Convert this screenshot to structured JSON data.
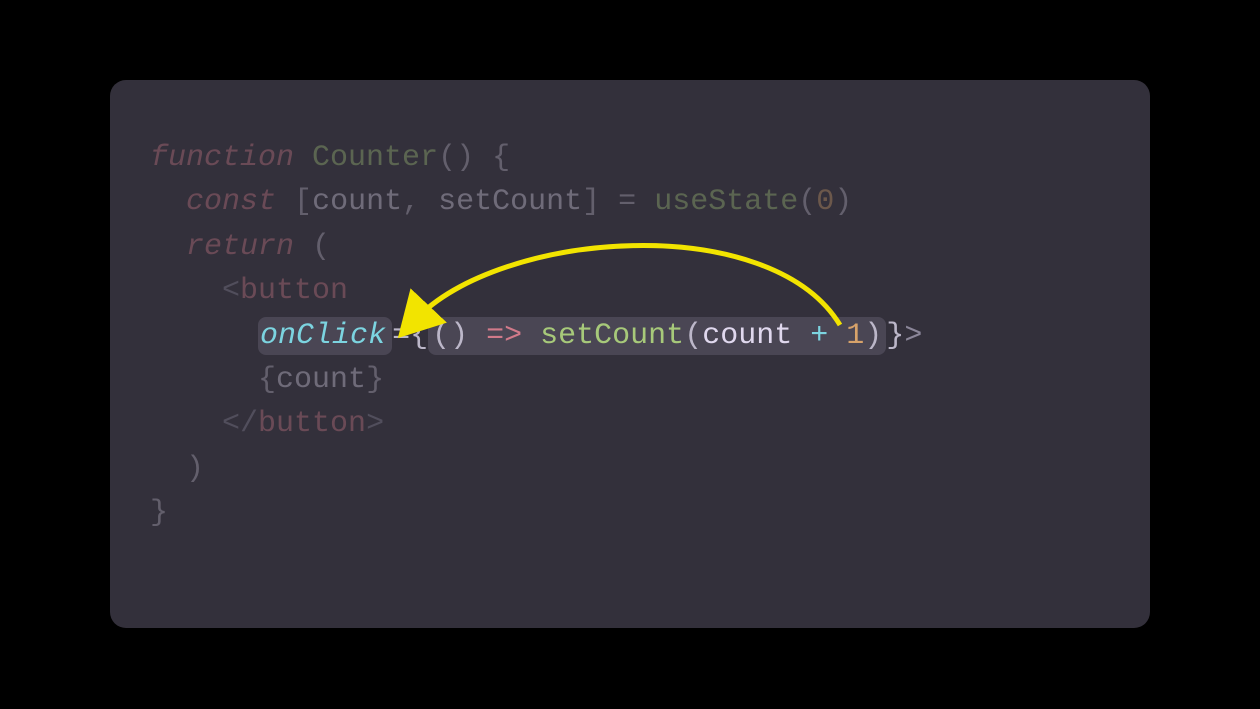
{
  "colors": {
    "panel_bg": "#33303b",
    "highlight_bg": "#4a4654",
    "arrow": "#f2e400",
    "keyword": "#d17a8a",
    "function": "#a7c97a",
    "variable": "#e0d8ee",
    "number": "#d7a26a",
    "attribute": "#7cd4e0",
    "punctuation": "#bcb7c9"
  },
  "code": {
    "l1": {
      "kw": "function",
      "sp1": " ",
      "fn": "Counter",
      "paren": "()",
      "sp2": " ",
      "brace": "{"
    },
    "l2": {
      "indent": "  ",
      "kw": "const",
      "sp1": " ",
      "lb": "[",
      "v1": "count",
      "comma": ",",
      "sp2": " ",
      "v2": "setCount",
      "rb": "]",
      "sp3": " ",
      "eq": "=",
      "sp4": " ",
      "fn": "useState",
      "lp": "(",
      "num": "0",
      "rp": ")"
    },
    "l3": {
      "indent": "  ",
      "kw": "return",
      "sp": " ",
      "paren": "("
    },
    "l4": {
      "indent": "    ",
      "lt": "<",
      "tag": "button"
    },
    "l5": {
      "indent": "      ",
      "attr": "onClick",
      "eq": "=",
      "lc": "{",
      "lp": "()",
      "sp1": " ",
      "arrow": "=>",
      "sp2": " ",
      "call": "setCount",
      "alp": "(",
      "arg": "count",
      "sp3": " ",
      "plus": "+",
      "sp4": " ",
      "one": "1",
      "arp": ")",
      "rc": "}",
      "gt": ">"
    },
    "l6": {
      "indent": "      ",
      "lc": "{",
      "var": "count",
      "rc": "}"
    },
    "l7": {
      "indent": "    ",
      "lt": "</",
      "tag": "button",
      "gt": ">"
    },
    "l8": {
      "indent": "  ",
      "paren": ")"
    },
    "l9": {
      "brace": "}"
    }
  },
  "annotation": {
    "type": "curved-arrow",
    "from": "lambda-body",
    "to": "onClick-attribute",
    "color": "#f2e400"
  }
}
